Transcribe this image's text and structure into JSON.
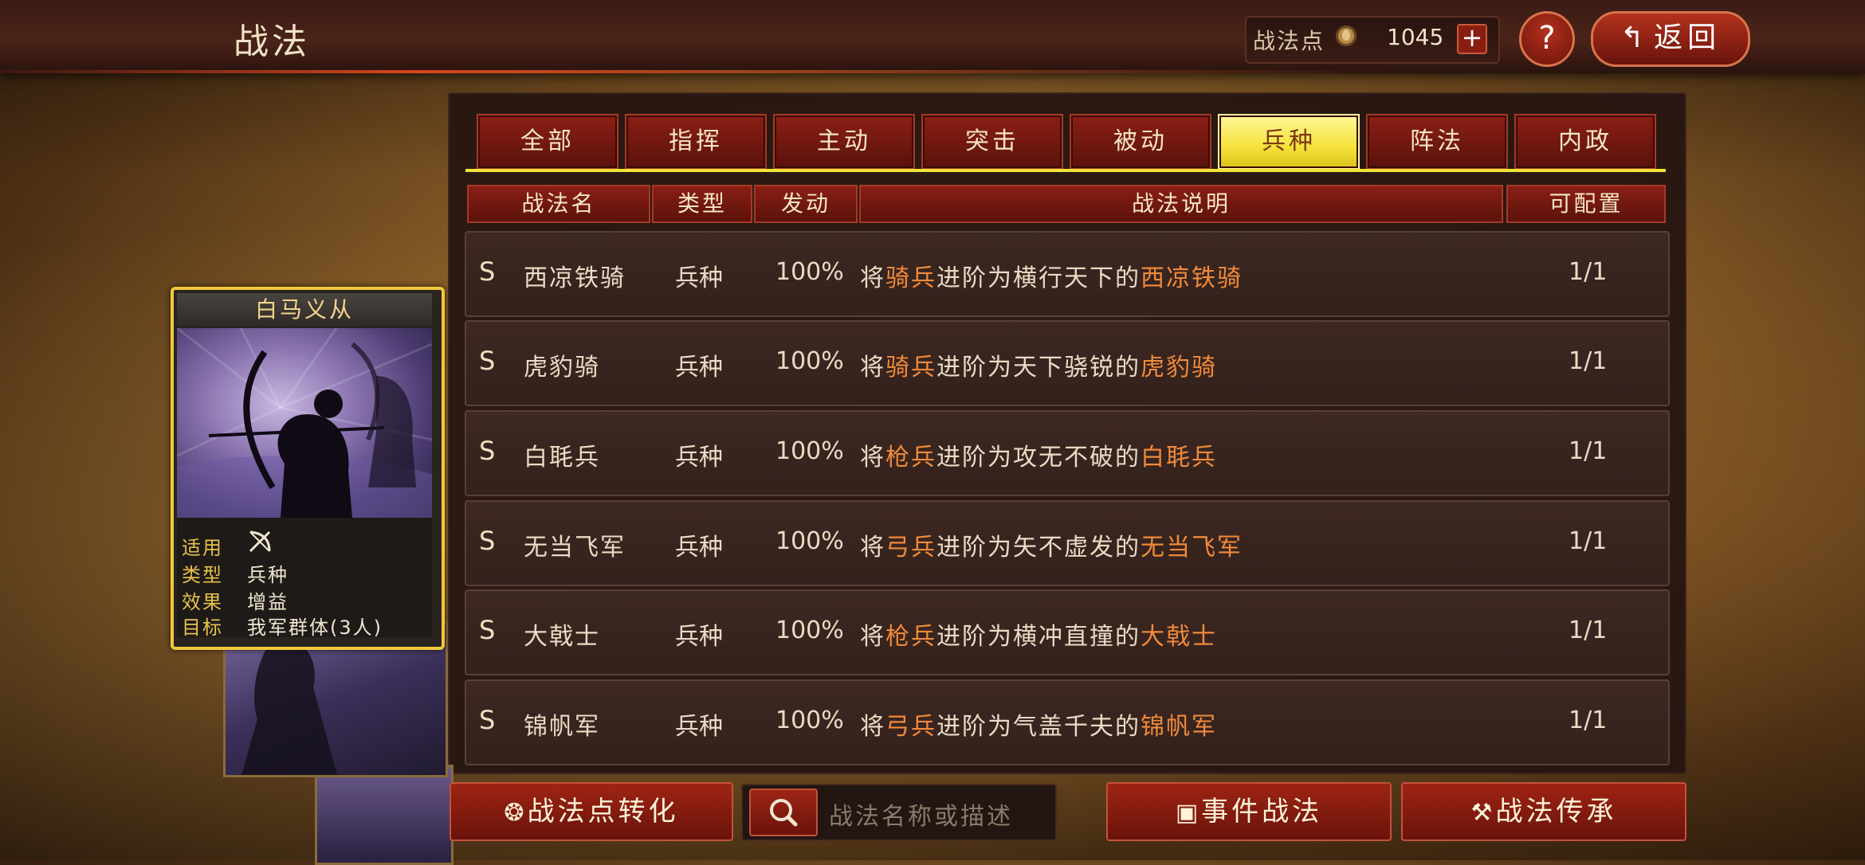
{
  "header": {
    "title": "战法",
    "points_label": "战法点",
    "points_value": "1045",
    "plus_label": "+",
    "help_label": "?",
    "back_label": "返回"
  },
  "tabs": [
    "全部",
    "指挥",
    "主动",
    "突击",
    "被动",
    "兵种",
    "阵法",
    "内政"
  ],
  "active_tab_index": 5,
  "columns": [
    "战法名",
    "类型",
    "发动",
    "战法说明",
    "可配置"
  ],
  "rows": [
    {
      "grade": "S",
      "name": "西凉铁骑",
      "type": "兵种",
      "rate": "100%",
      "desc": [
        "将",
        "骑兵",
        "进阶为横行天下的",
        "西凉铁骑"
      ],
      "config": "1/1"
    },
    {
      "grade": "S",
      "name": "虎豹骑",
      "type": "兵种",
      "rate": "100%",
      "desc": [
        "将",
        "骑兵",
        "进阶为天下骁锐的",
        "虎豹骑"
      ],
      "config": "1/1"
    },
    {
      "grade": "S",
      "name": "白毦兵",
      "type": "兵种",
      "rate": "100%",
      "desc": [
        "将",
        "枪兵",
        "进阶为攻无不破的",
        "白毦兵"
      ],
      "config": "1/1"
    },
    {
      "grade": "S",
      "name": "无当飞军",
      "type": "兵种",
      "rate": "100%",
      "desc": [
        "将",
        "弓兵",
        "进阶为矢不虚发的",
        "无当飞军"
      ],
      "config": "1/1"
    },
    {
      "grade": "S",
      "name": "大戟士",
      "type": "兵种",
      "rate": "100%",
      "desc": [
        "将",
        "枪兵",
        "进阶为横冲直撞的",
        "大戟士"
      ],
      "config": "1/1"
    },
    {
      "grade": "S",
      "name": "锦帆军",
      "type": "兵种",
      "rate": "100%",
      "desc": [
        "将",
        "弓兵",
        "进阶为气盖千夫的",
        "锦帆军"
      ],
      "config": "1/1"
    }
  ],
  "card": {
    "title": "白马义从",
    "apply_label": "适用",
    "apply_icon": "bow-icon",
    "type_label": "类型",
    "type_value": "兵种",
    "effect_label": "效果",
    "effect_value": "增益",
    "target_label": "目标",
    "target_value": "我军群体(3人)"
  },
  "bottom": {
    "convert_label": "战法点转化",
    "search_placeholder": "战法名称或描述",
    "event_label": "事件战法",
    "inherit_label": "战法传承"
  },
  "colors": {
    "accent_red": "#8b1f15",
    "active_tab": "#f5e23a",
    "highlight_text": "#f08a3a",
    "card_border": "#f0c83a"
  }
}
